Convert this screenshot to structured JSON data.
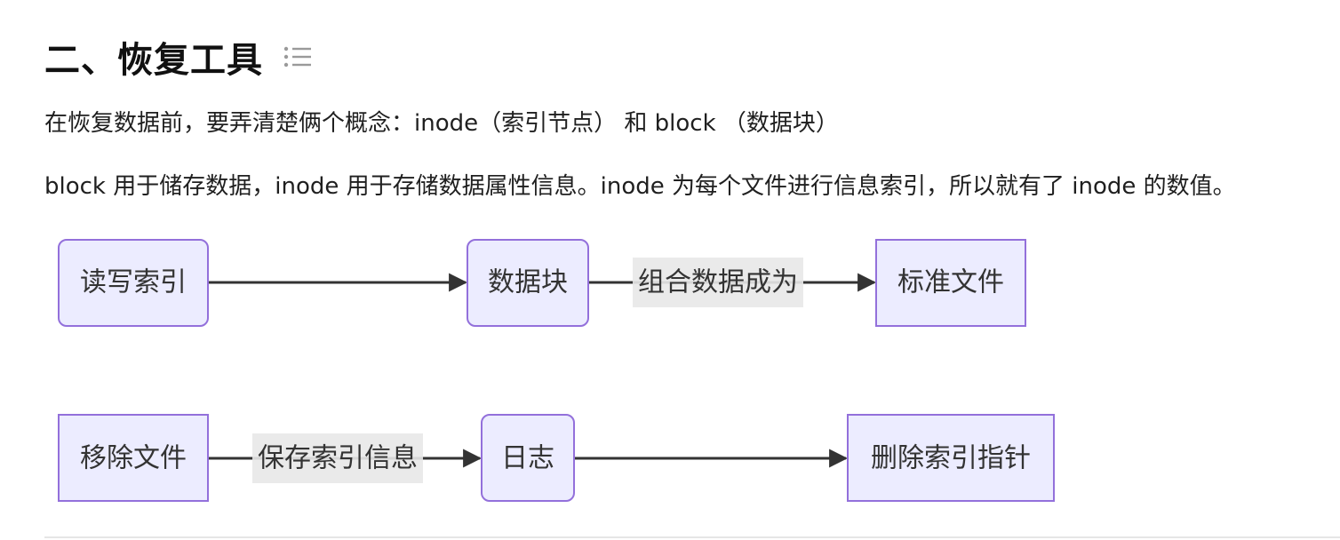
{
  "heading": {
    "title": "二、恢复工具",
    "toc_icon": "list-icon"
  },
  "paragraphs": [
    "在恢复数据前，要弄清楚俩个概念：inode（索引节点） 和 block （数据块）",
    "block 用于储存数据，inode 用于存储数据属性信息。inode 为每个文件进行信息索引，所以就有了 inode 的数值。"
  ],
  "diagram": {
    "colors": {
      "node_fill": "#ececff",
      "node_border": "#9370db",
      "edge": "#333333",
      "label_bg": "#e8e8e8"
    },
    "nodes": {
      "read_write_index": "读写索引",
      "data_block": "数据块",
      "standard_file": "标准文件",
      "remove_file": "移除文件",
      "log": "日志",
      "delete_index_pointer": "删除索引指针"
    },
    "edges": [
      {
        "from": "read_write_index",
        "to": "data_block",
        "label": ""
      },
      {
        "from": "data_block",
        "to": "standard_file",
        "label": "组合数据成为"
      },
      {
        "from": "remove_file",
        "to": "log",
        "label": "保存索引信息"
      },
      {
        "from": "log",
        "to": "delete_index_pointer",
        "label": ""
      }
    ]
  }
}
